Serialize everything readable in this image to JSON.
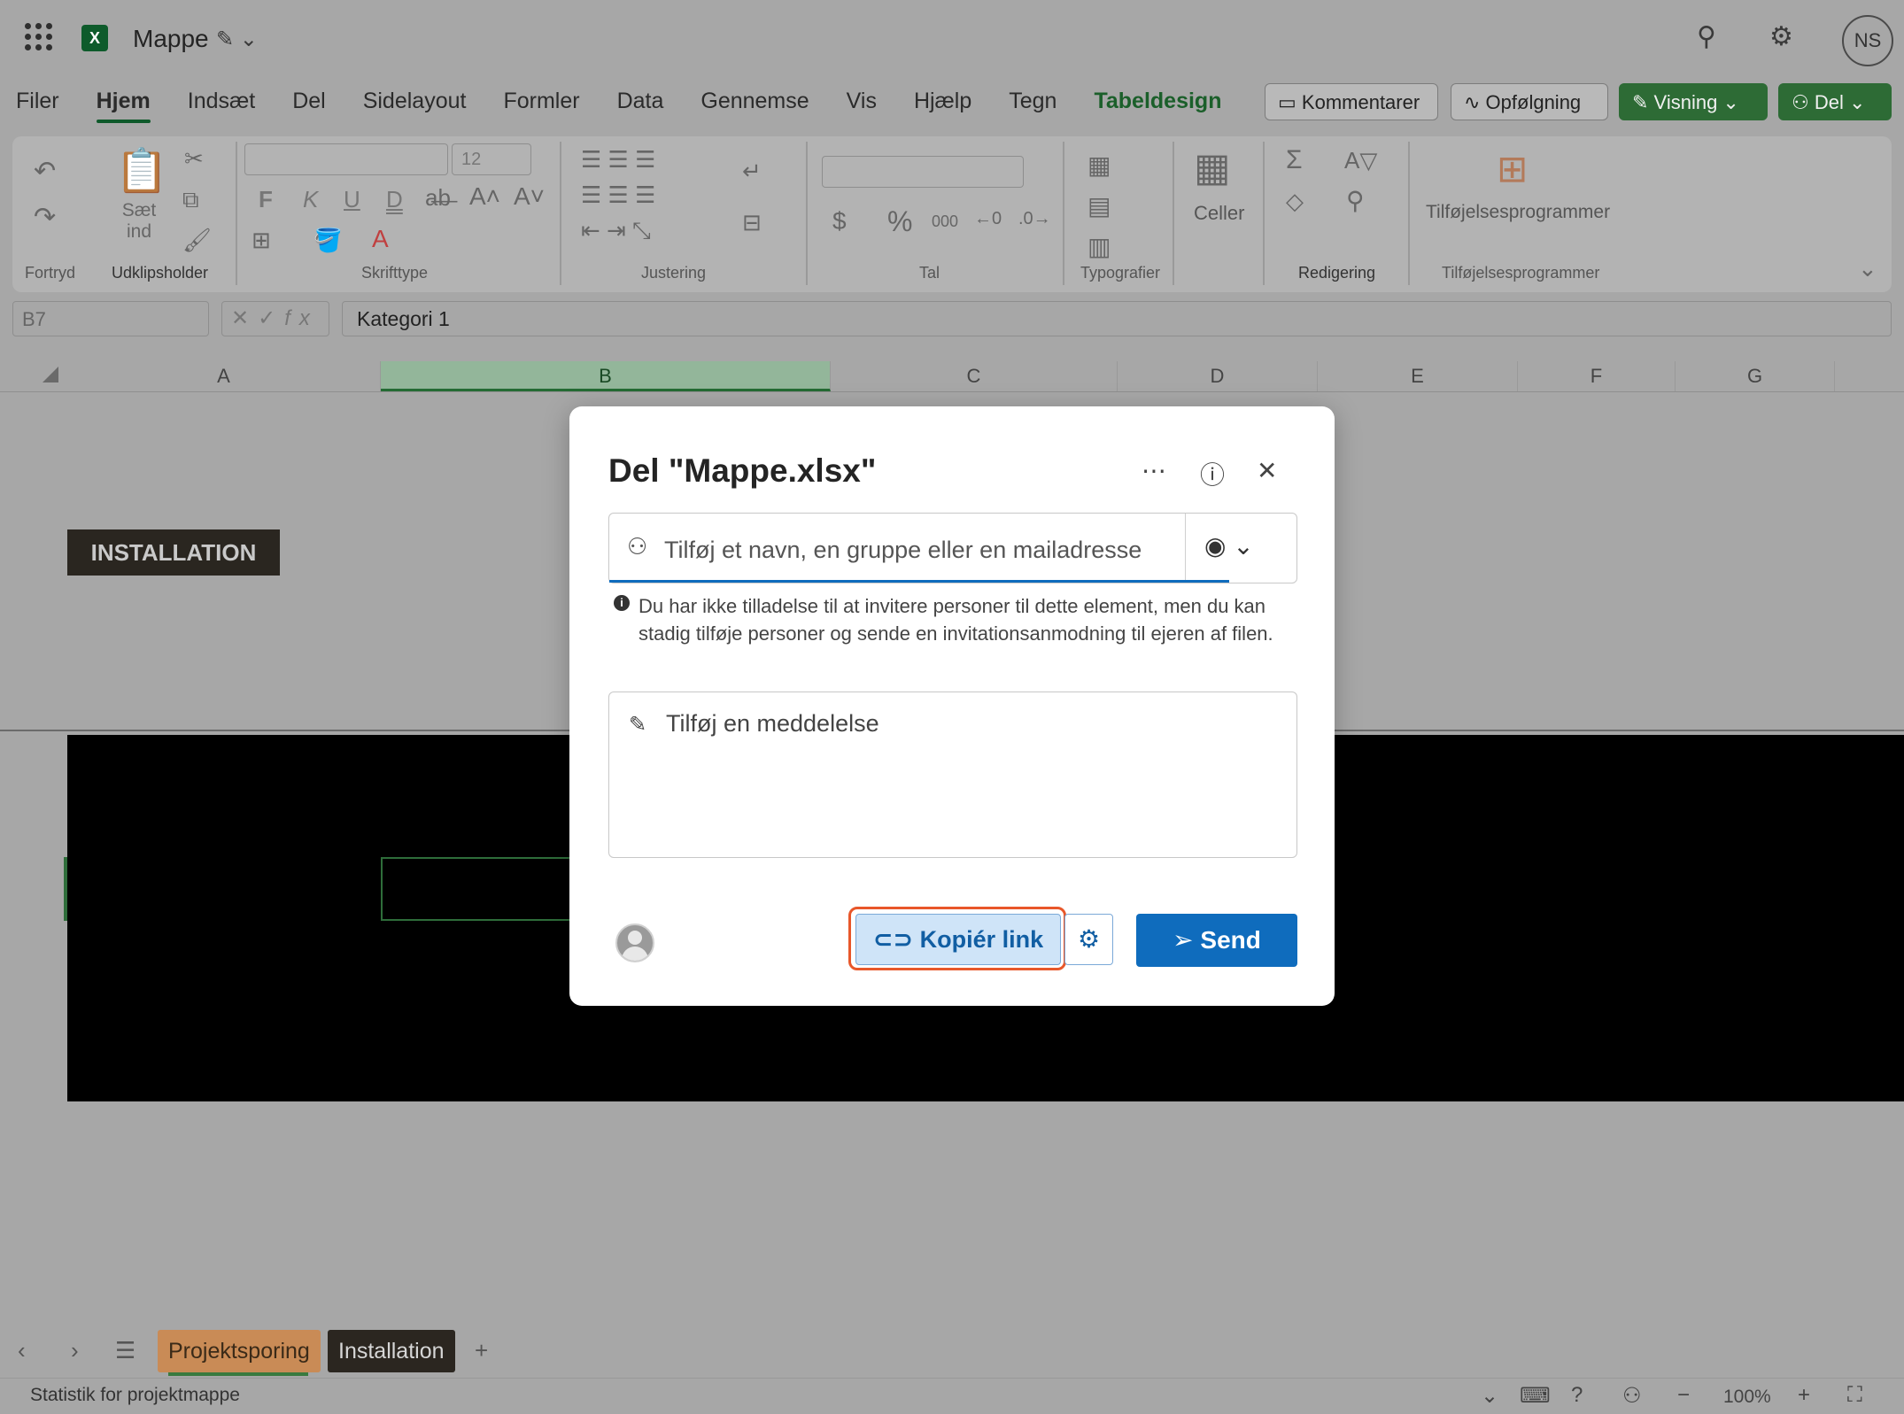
{
  "app": {
    "doc_title": "Mappe",
    "user_initials": "NS"
  },
  "menu": {
    "tabs": [
      "Filer",
      "Hjem",
      "Indsæt",
      "Del",
      "Sidelayout",
      "Formler",
      "Data",
      "Gennemse",
      "Vis",
      "Hjælp",
      "Tegn",
      "Tabeldesign"
    ],
    "active": "Hjem",
    "buttons": {
      "comments": "Kommentarer",
      "followup": "Opfølgning",
      "view": "Visning",
      "share": "Del"
    }
  },
  "ribbon": {
    "groups": {
      "undo": "Fortryd",
      "clipboard": "Udklipsholder",
      "font": "Skrifttype",
      "alignment": "Justering",
      "number": "Tal",
      "styles": "Typografier",
      "editing": "Redigering",
      "addins": "Tilføjelsesprogrammer"
    },
    "paste_label": "Sæt ind",
    "font_size": "12",
    "font_buttons": [
      "F",
      "K",
      "U",
      "D"
    ],
    "cells_label": "Celler",
    "addins_label": "Tilføjelsesprogrammer"
  },
  "formula_bar": {
    "cell_ref": "B7",
    "value": "Kategori 1"
  },
  "grid": {
    "columns": [
      "A",
      "B",
      "C",
      "D",
      "E",
      "F",
      "G"
    ],
    "selected_column": "B",
    "install_header": "INSTALLATION"
  },
  "sheets": {
    "tabs": [
      "Projektsporing",
      "Installation"
    ]
  },
  "status": {
    "text": "Statistik for projektmappe",
    "zoom": "100%"
  },
  "dialog": {
    "title": "Del \"Mappe.xlsx\"",
    "recipient_placeholder": "Tilføj et navn, en gruppe eller en mailadresse",
    "info_text": "Du har ikke tilladelse til at invitere personer til dette element, men du kan stadig tilføje personer og sende en invitationsanmodning til ejeren af filen.",
    "message_placeholder": "Tilføj en meddelelse",
    "copy_link_label": "Kopiér link",
    "send_label": "Send"
  },
  "colors": {
    "accent_blue": "#0f6cbd",
    "excel_green": "#2d6b35",
    "highlight_orange": "#e8572a"
  }
}
